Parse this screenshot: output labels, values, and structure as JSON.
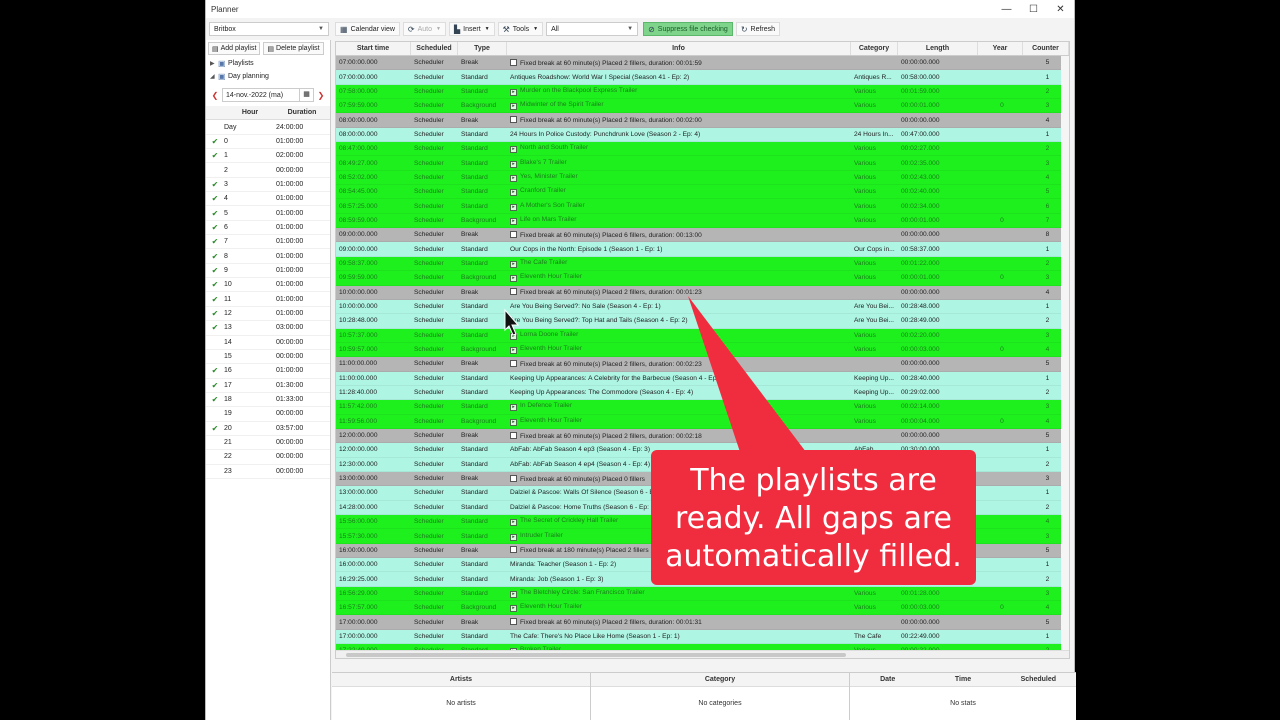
{
  "window": {
    "title": "Planner",
    "min": "—",
    "max": "☐",
    "close": "✕"
  },
  "toolbar": {
    "channel": "Britbox",
    "calendar_view": "Calendar view",
    "auto": "Auto",
    "insert": "Insert",
    "tools": "Tools",
    "filter": "All",
    "suppress": "Suppress file checking",
    "refresh": "Refresh"
  },
  "left": {
    "add_playlist": "Add playlist",
    "delete_playlist": "Delete playlist",
    "tree": [
      {
        "label": "Playlists",
        "expand": "▶"
      },
      {
        "label": "Day planning",
        "expand": "◢"
      }
    ],
    "date": "14-nov.-2022 (ma)",
    "hours_head": {
      "hour": "Hour",
      "duration": "Duration"
    },
    "hours": [
      {
        "check": "",
        "hour": "Day",
        "dur": "24:00:00"
      },
      {
        "check": "✔",
        "hour": "0",
        "dur": "01:00:00"
      },
      {
        "check": "✔",
        "hour": "1",
        "dur": "02:00:00"
      },
      {
        "check": "",
        "hour": "2",
        "dur": "00:00:00"
      },
      {
        "check": "✔",
        "hour": "3",
        "dur": "01:00:00"
      },
      {
        "check": "✔",
        "hour": "4",
        "dur": "01:00:00"
      },
      {
        "check": "✔",
        "hour": "5",
        "dur": "01:00:00"
      },
      {
        "check": "✔",
        "hour": "6",
        "dur": "01:00:00"
      },
      {
        "check": "✔",
        "hour": "7",
        "dur": "01:00:00"
      },
      {
        "check": "✔",
        "hour": "8",
        "dur": "01:00:00"
      },
      {
        "check": "✔",
        "hour": "9",
        "dur": "01:00:00"
      },
      {
        "check": "✔",
        "hour": "10",
        "dur": "01:00:00"
      },
      {
        "check": "✔",
        "hour": "11",
        "dur": "01:00:00"
      },
      {
        "check": "✔",
        "hour": "12",
        "dur": "01:00:00"
      },
      {
        "check": "✔",
        "hour": "13",
        "dur": "03:00:00"
      },
      {
        "check": "",
        "hour": "14",
        "dur": "00:00:00"
      },
      {
        "check": "",
        "hour": "15",
        "dur": "00:00:00"
      },
      {
        "check": "✔",
        "hour": "16",
        "dur": "01:00:00"
      },
      {
        "check": "✔",
        "hour": "17",
        "dur": "01:30:00"
      },
      {
        "check": "✔",
        "hour": "18",
        "dur": "01:33:00"
      },
      {
        "check": "",
        "hour": "19",
        "dur": "00:00:00"
      },
      {
        "check": "✔",
        "hour": "20",
        "dur": "03:57:00"
      },
      {
        "check": "",
        "hour": "21",
        "dur": "00:00:00"
      },
      {
        "check": "",
        "hour": "22",
        "dur": "00:00:00"
      },
      {
        "check": "",
        "hour": "23",
        "dur": "00:00:00"
      }
    ]
  },
  "grid": {
    "columns": [
      "Start time",
      "Scheduled",
      "Type",
      "Info",
      "Category",
      "Length",
      "Year",
      "Counter"
    ],
    "rows": [
      {
        "kind": "break",
        "start": "07:00:00.000",
        "sched": "Scheduler",
        "type": "Break",
        "icon": true,
        "info": "Fixed break at 60 minute(s) Placed 2 fillers, duration: 00:01:59",
        "cat": "",
        "len": "00:00:00.000",
        "year": "",
        "count": "5"
      },
      {
        "kind": "program",
        "start": "07:00:00.000",
        "sched": "Scheduler",
        "type": "Standard",
        "icon": false,
        "info": "Antiques Roadshow: World War I Special (Season 41 - Ep: 2)",
        "cat": "Antiques R...",
        "len": "00:58:00.000",
        "year": "",
        "count": "1"
      },
      {
        "kind": "trailer",
        "start": "07:58:00.000",
        "sched": "Scheduler",
        "type": "Standard",
        "icon": true,
        "info": "Murder on the Blackpool Express Trailer",
        "cat": "Various",
        "len": "00:01:59.000",
        "year": "",
        "count": "2"
      },
      {
        "kind": "trailer",
        "start": "07:59:59.000",
        "sched": "Scheduler",
        "type": "Background",
        "icon": true,
        "info": "Midwinter of the Spirit Trailer",
        "cat": "Various",
        "len": "00:00:01.000",
        "year": "0",
        "count": "3"
      },
      {
        "kind": "break",
        "start": "08:00:00.000",
        "sched": "Scheduler",
        "type": "Break",
        "icon": true,
        "info": "Fixed break at 60 minute(s) Placed 2 fillers, duration: 00:02:00",
        "cat": "",
        "len": "00:00:00.000",
        "year": "",
        "count": "4"
      },
      {
        "kind": "program",
        "start": "08:00:00.000",
        "sched": "Scheduler",
        "type": "Standard",
        "icon": false,
        "info": "24 Hours In Police Custody: Punchdrunk Love (Season 2 - Ep: 4)",
        "cat": "24 Hours In...",
        "len": "00:47:00.000",
        "year": "",
        "count": "1"
      },
      {
        "kind": "trailer",
        "start": "08:47:00.000",
        "sched": "Scheduler",
        "type": "Standard",
        "icon": true,
        "info": "North and South Trailer",
        "cat": "Various",
        "len": "00:02:27.000",
        "year": "",
        "count": "2"
      },
      {
        "kind": "trailer",
        "start": "08:49:27.000",
        "sched": "Scheduler",
        "type": "Standard",
        "icon": true,
        "info": "Blake's 7 Trailer",
        "cat": "Various",
        "len": "00:02:35.000",
        "year": "",
        "count": "3"
      },
      {
        "kind": "trailer",
        "start": "08:52:02.000",
        "sched": "Scheduler",
        "type": "Standard",
        "icon": true,
        "info": "Yes, Minister Trailer",
        "cat": "Various",
        "len": "00:02:43.000",
        "year": "",
        "count": "4"
      },
      {
        "kind": "trailer",
        "start": "08:54:45.000",
        "sched": "Scheduler",
        "type": "Standard",
        "icon": true,
        "info": "Cranford Trailer",
        "cat": "Various",
        "len": "00:02:40.000",
        "year": "",
        "count": "5"
      },
      {
        "kind": "trailer",
        "start": "08:57:25.000",
        "sched": "Scheduler",
        "type": "Standard",
        "icon": true,
        "info": "A Mother's Son Trailer",
        "cat": "Various",
        "len": "00:02:34.000",
        "year": "",
        "count": "6"
      },
      {
        "kind": "trailer",
        "start": "08:59:59.000",
        "sched": "Scheduler",
        "type": "Background",
        "icon": true,
        "info": "Life on Mars Trailer",
        "cat": "Various",
        "len": "00:00:01.000",
        "year": "0",
        "count": "7"
      },
      {
        "kind": "break",
        "start": "09:00:00.000",
        "sched": "Scheduler",
        "type": "Break",
        "icon": true,
        "info": "Fixed break at 60 minute(s) Placed 6 fillers, duration: 00:13:00",
        "cat": "",
        "len": "00:00:00.000",
        "year": "",
        "count": "8"
      },
      {
        "kind": "program",
        "start": "09:00:00.000",
        "sched": "Scheduler",
        "type": "Standard",
        "icon": false,
        "info": "Our Cops in the North: Episode 1 (Season 1 - Ep: 1)",
        "cat": "Our Cops in...",
        "len": "00:58:37.000",
        "year": "",
        "count": "1"
      },
      {
        "kind": "trailer",
        "start": "09:58:37.000",
        "sched": "Scheduler",
        "type": "Standard",
        "icon": true,
        "info": "The Cafe Trailer",
        "cat": "Various",
        "len": "00:01:22.000",
        "year": "",
        "count": "2"
      },
      {
        "kind": "trailer",
        "start": "09:59:59.000",
        "sched": "Scheduler",
        "type": "Background",
        "icon": true,
        "info": "Eleventh Hour Trailer",
        "cat": "Various",
        "len": "00:00:01.000",
        "year": "0",
        "count": "3"
      },
      {
        "kind": "break",
        "start": "10:00:00.000",
        "sched": "Scheduler",
        "type": "Break",
        "icon": true,
        "info": "Fixed break at 60 minute(s) Placed 2 fillers, duration: 00:01:23",
        "cat": "",
        "len": "00:00:00.000",
        "year": "",
        "count": "4"
      },
      {
        "kind": "program",
        "start": "10:00:00.000",
        "sched": "Scheduler",
        "type": "Standard",
        "icon": false,
        "info": "Are You Being Served?: No Sale (Season 4 - Ep: 1)",
        "cat": "Are You Bei...",
        "len": "00:28:48.000",
        "year": "",
        "count": "1"
      },
      {
        "kind": "program",
        "start": "10:28:48.000",
        "sched": "Scheduler",
        "type": "Standard",
        "icon": false,
        "info": "Are You Being Served?: Top Hat and Tails (Season 4 - Ep: 2)",
        "cat": "Are You Bei...",
        "len": "00:28:49.000",
        "year": "",
        "count": "2"
      },
      {
        "kind": "trailer",
        "start": "10:57:37.000",
        "sched": "Scheduler",
        "type": "Standard",
        "icon": true,
        "info": "Lorna Doone Trailer",
        "cat": "Various",
        "len": "00:02:20.000",
        "year": "",
        "count": "3"
      },
      {
        "kind": "trailer",
        "start": "10:59:57.000",
        "sched": "Scheduler",
        "type": "Background",
        "icon": true,
        "info": "Eleventh Hour Trailer",
        "cat": "Various",
        "len": "00:00:03.000",
        "year": "0",
        "count": "4"
      },
      {
        "kind": "break",
        "start": "11:00:00.000",
        "sched": "Scheduler",
        "type": "Break",
        "icon": true,
        "info": "Fixed break at 60 minute(s) Placed 2 fillers, duration: 00:02:23",
        "cat": "",
        "len": "00:00:00.000",
        "year": "",
        "count": "5"
      },
      {
        "kind": "program",
        "start": "11:00:00.000",
        "sched": "Scheduler",
        "type": "Standard",
        "icon": false,
        "info": "Keeping Up Appearances: A Celebrity for the Barbecue (Season 4 - Ep: 3)",
        "cat": "Keeping Up...",
        "len": "00:28:40.000",
        "year": "",
        "count": "1"
      },
      {
        "kind": "program",
        "start": "11:28:40.000",
        "sched": "Scheduler",
        "type": "Standard",
        "icon": false,
        "info": "Keeping Up Appearances: The Commodore (Season 4 - Ep: 4)",
        "cat": "Keeping Up...",
        "len": "00:29:02.000",
        "year": "",
        "count": "2"
      },
      {
        "kind": "trailer",
        "start": "11:57:42.000",
        "sched": "Scheduler",
        "type": "Standard",
        "icon": true,
        "info": "In Defence Trailer",
        "cat": "Various",
        "len": "00:02:14.000",
        "year": "",
        "count": "3"
      },
      {
        "kind": "trailer",
        "start": "11:59:56.000",
        "sched": "Scheduler",
        "type": "Background",
        "icon": true,
        "info": "Eleventh Hour Trailer",
        "cat": "Various",
        "len": "00:00:04.000",
        "year": "0",
        "count": "4"
      },
      {
        "kind": "break",
        "start": "12:00:00.000",
        "sched": "Scheduler",
        "type": "Break",
        "icon": true,
        "info": "Fixed break at 60 minute(s) Placed 2 fillers, duration: 00:02:18",
        "cat": "",
        "len": "00:00:00.000",
        "year": "",
        "count": "5"
      },
      {
        "kind": "program",
        "start": "12:00:00.000",
        "sched": "Scheduler",
        "type": "Standard",
        "icon": false,
        "info": "AbFab: AbFab Season 4 ep3 (Season 4 - Ep: 3)",
        "cat": "AbFab",
        "len": "00:30:00.000",
        "year": "",
        "count": "1"
      },
      {
        "kind": "program",
        "start": "12:30:00.000",
        "sched": "Scheduler",
        "type": "Standard",
        "icon": false,
        "info": "AbFab: AbFab Season 4 ep4 (Season 4 - Ep: 4)",
        "cat": "AbFab",
        "len": "00:30:00.000",
        "year": "",
        "count": "2"
      },
      {
        "kind": "break",
        "start": "13:00:00.000",
        "sched": "Scheduler",
        "type": "Break",
        "icon": true,
        "info": "Fixed break at 60 minute(s) Placed 0 fillers",
        "cat": "",
        "len": "00:00:00.000",
        "year": "",
        "count": "3"
      },
      {
        "kind": "program",
        "start": "13:00:00.000",
        "sched": "Scheduler",
        "type": "Standard",
        "icon": false,
        "info": "Dalziel & Pascoe: Walls Of Silence (Season 6 - Ep: 1)",
        "cat": "Dalziel & P...",
        "len": "01:28:00.000",
        "year": "",
        "count": "1"
      },
      {
        "kind": "program",
        "start": "14:28:00.000",
        "sched": "Scheduler",
        "type": "Standard",
        "icon": false,
        "info": "Dalziel & Pascoe: Home Truths (Season 6 - Ep: 2)",
        "cat": "Dalziel & P...",
        "len": "01:28:00.000",
        "year": "",
        "count": "2"
      },
      {
        "kind": "trailer",
        "start": "15:56:00.000",
        "sched": "Scheduler",
        "type": "Standard",
        "icon": true,
        "info": "The Secret of Crickley Hall Trailer",
        "cat": "Various",
        "len": "00:01:30.000",
        "year": "",
        "count": "4"
      },
      {
        "kind": "trailer",
        "start": "15:57:30.000",
        "sched": "Scheduler",
        "type": "Standard",
        "icon": true,
        "info": "Intruder Trailer",
        "cat": "Various",
        "len": "00:02:30.000",
        "year": "",
        "count": "3"
      },
      {
        "kind": "break",
        "start": "16:00:00.000",
        "sched": "Scheduler",
        "type": "Break",
        "icon": true,
        "info": "Fixed break at 180 minute(s) Placed 2 fillers",
        "cat": "",
        "len": "00:00:00.000",
        "year": "",
        "count": "5"
      },
      {
        "kind": "program",
        "start": "16:00:00.000",
        "sched": "Scheduler",
        "type": "Standard",
        "icon": false,
        "info": "Miranda: Teacher (Season 1 - Ep: 2)",
        "cat": "Miranda",
        "len": "00:29:25.000",
        "year": "",
        "count": "1"
      },
      {
        "kind": "program",
        "start": "16:29:25.000",
        "sched": "Scheduler",
        "type": "Standard",
        "icon": false,
        "info": "Miranda: Job (Season 1 - Ep: 3)",
        "cat": "Miranda",
        "len": "00:27:04.000",
        "year": "",
        "count": "2"
      },
      {
        "kind": "trailer",
        "start": "16:56:29.000",
        "sched": "Scheduler",
        "type": "Standard",
        "icon": true,
        "info": "The Bletchley Circle: San Francisco Trailer",
        "cat": "Various",
        "len": "00:01:28.000",
        "year": "",
        "count": "3"
      },
      {
        "kind": "trailer",
        "start": "16:57:57.000",
        "sched": "Scheduler",
        "type": "Background",
        "icon": true,
        "info": "Eleventh Hour Trailer",
        "cat": "Various",
        "len": "00:00:03.000",
        "year": "0",
        "count": "4"
      },
      {
        "kind": "break",
        "start": "17:00:00.000",
        "sched": "Scheduler",
        "type": "Break",
        "icon": true,
        "info": "Fixed break at 60 minute(s) Placed 2 fillers, duration: 00:01:31",
        "cat": "",
        "len": "00:00:00.000",
        "year": "",
        "count": "5"
      },
      {
        "kind": "program",
        "start": "17:00:00.000",
        "sched": "Scheduler",
        "type": "Standard",
        "icon": false,
        "info": "The Cafe: There's No Place Like Home (Season 1 - Ep: 1)",
        "cat": "The Cafe",
        "len": "00:22:49.000",
        "year": "",
        "count": "1"
      },
      {
        "kind": "trailer",
        "start": "17:22:49.000",
        "sched": "Scheduler",
        "type": "Standard",
        "icon": true,
        "info": "Broken Trailer",
        "cat": "Various",
        "len": "00:00:22.000",
        "year": "",
        "count": "2"
      }
    ]
  },
  "bottom": {
    "artists_head": "Artists",
    "artists_empty": "No artists",
    "category_head": "Category",
    "category_empty": "No categories",
    "stats_head": [
      "Date",
      "Time",
      "Scheduled"
    ],
    "stats_empty": "No stats"
  },
  "callout": {
    "lines": [
      "The playlists are",
      "ready. All gaps are",
      "automatically filled."
    ],
    "color": "#ef2d3e"
  }
}
